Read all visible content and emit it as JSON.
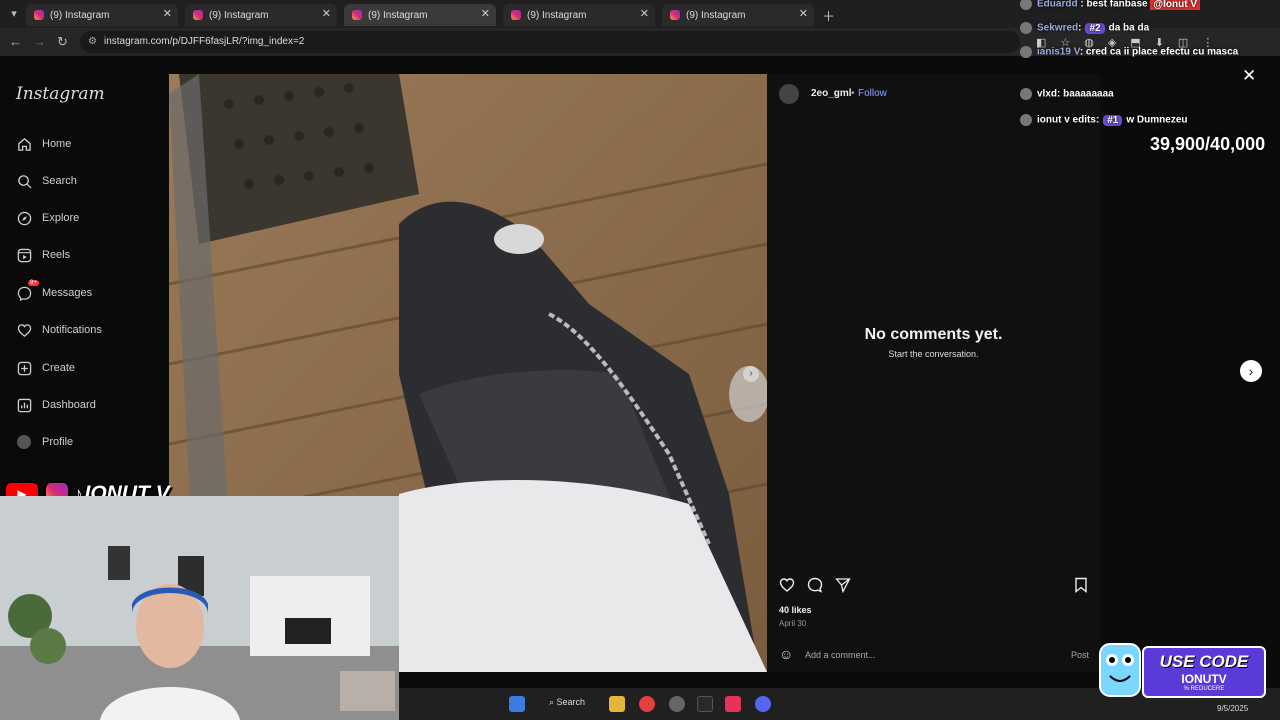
{
  "browser": {
    "tabs": [
      {
        "title": "(9) Instagram"
      },
      {
        "title": "(9) Instagram"
      },
      {
        "title": "(9) Instagram"
      },
      {
        "title": "(9) Instagram"
      },
      {
        "title": "(9) Instagram"
      }
    ],
    "url": "instagram.com/p/DJFF6fasjLR/?img_index=2"
  },
  "sidebar": {
    "logo": "Instagram",
    "items": [
      {
        "label": "Home",
        "icon": "home-icon"
      },
      {
        "label": "Search",
        "icon": "search-icon"
      },
      {
        "label": "Explore",
        "icon": "compass-icon"
      },
      {
        "label": "Reels",
        "icon": "reels-icon"
      },
      {
        "label": "Messages",
        "icon": "messenger-icon"
      },
      {
        "label": "Notifications",
        "icon": "heart-icon"
      },
      {
        "label": "Create",
        "icon": "plus-square-icon"
      },
      {
        "label": "Dashboard",
        "icon": "dashboard-icon"
      },
      {
        "label": "Profile",
        "icon": "profile-icon"
      }
    ]
  },
  "post": {
    "username": "2eo_gml",
    "separator": "•",
    "follow_label": "Follow",
    "no_comments_title": "No comments yet.",
    "no_comments_sub": "Start the conversation.",
    "likes": "40 likes",
    "date": "April 30",
    "comment_placeholder": "Add a comment...",
    "post_label": "Post"
  },
  "overlay": {
    "chat": [
      {
        "name": "Eduardd",
        "message": "best fanbase",
        "extra": "@Ionut V"
      },
      {
        "name": "Sekwred",
        "badge": "#2",
        "message": "da ba da"
      },
      {
        "name": "ianis19 V",
        "message": "cred ca ii place efectu cu masca"
      },
      {
        "name": "vlxd",
        "message": "baaaaaaaa"
      },
      {
        "name": "ionut v edits",
        "badge": "#1",
        "message": "w Dumnezeu"
      }
    ],
    "goal": "39,900/40,000",
    "streamer_name": "IONUT V",
    "promo_line1": "USE CODE",
    "promo_line2": "IONUTV",
    "promo_line3": "% REDUCERE"
  },
  "taskbar": {
    "search_label": "Search",
    "date": "9/5/2025"
  },
  "colors": {
    "follow": "#8ea6ff",
    "promo": "#5a3bd8",
    "youtube": "#ff0000"
  }
}
